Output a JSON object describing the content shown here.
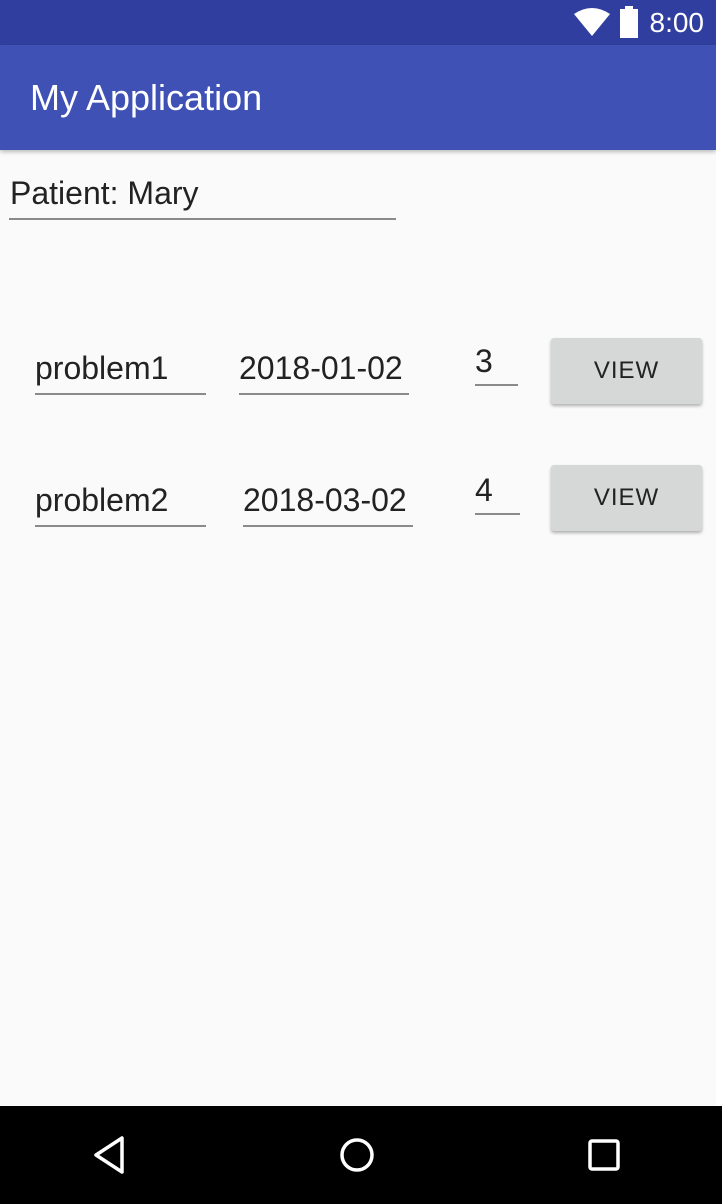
{
  "status_bar": {
    "time": "8:00",
    "icons": [
      "wifi-icon",
      "battery-icon"
    ]
  },
  "app_bar": {
    "title": "My Application"
  },
  "patient": {
    "label": "Patient: Mary"
  },
  "problems": [
    {
      "name": "problem1",
      "date": "2018-01-02",
      "count": "3",
      "button_label": "VIEW"
    },
    {
      "name": "problem2",
      "date": "2018-03-02",
      "count": "4",
      "button_label": "VIEW"
    }
  ],
  "nav_bar": {
    "icons": [
      "back-icon",
      "home-icon",
      "recents-icon"
    ]
  },
  "colors": {
    "status_bar": "#303f9f",
    "app_bar": "#3f51b5",
    "background": "#fafafa",
    "button": "#d6d7d7"
  }
}
